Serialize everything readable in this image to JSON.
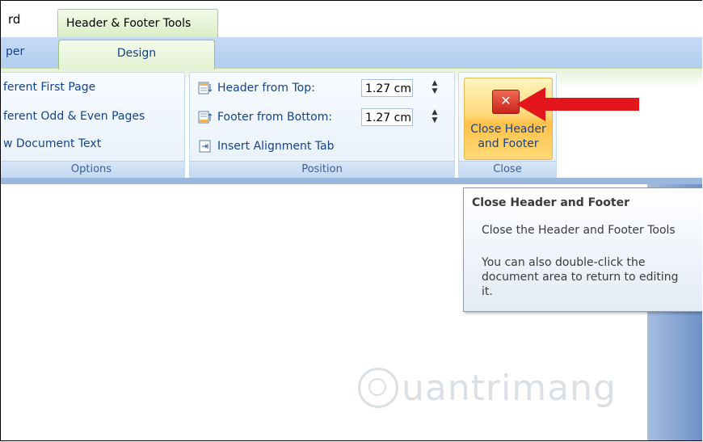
{
  "window": {
    "title_fragment": "rd"
  },
  "contextual_group": {
    "label": "Header & Footer Tools"
  },
  "tabs": {
    "partial_tab": "per",
    "active_tab": "Design"
  },
  "options_group": {
    "items": [
      "ferent First Page",
      "ferent Odd & Even Pages",
      "w Document Text"
    ],
    "label": "Options"
  },
  "position_group": {
    "header_label": "Header from Top:",
    "header_value": "1.27 cm",
    "footer_label": "Footer from Bottom:",
    "footer_value": "1.27 cm",
    "insert_tab": "Insert Alignment Tab",
    "label": "Position"
  },
  "close_group": {
    "button_line1": "Close Header",
    "button_line2": "and Footer",
    "label": "Close"
  },
  "tooltip": {
    "title": "Close Header and Footer",
    "line1": "Close the Header and Footer Tools",
    "line2": "You can also double-click the",
    "line3": "document area to return to editing",
    "line4": "it."
  },
  "watermark": {
    "text": "uantrimang"
  },
  "colors": {
    "accent_arrow": "#e3161b",
    "ribbon_text": "#15428b"
  }
}
